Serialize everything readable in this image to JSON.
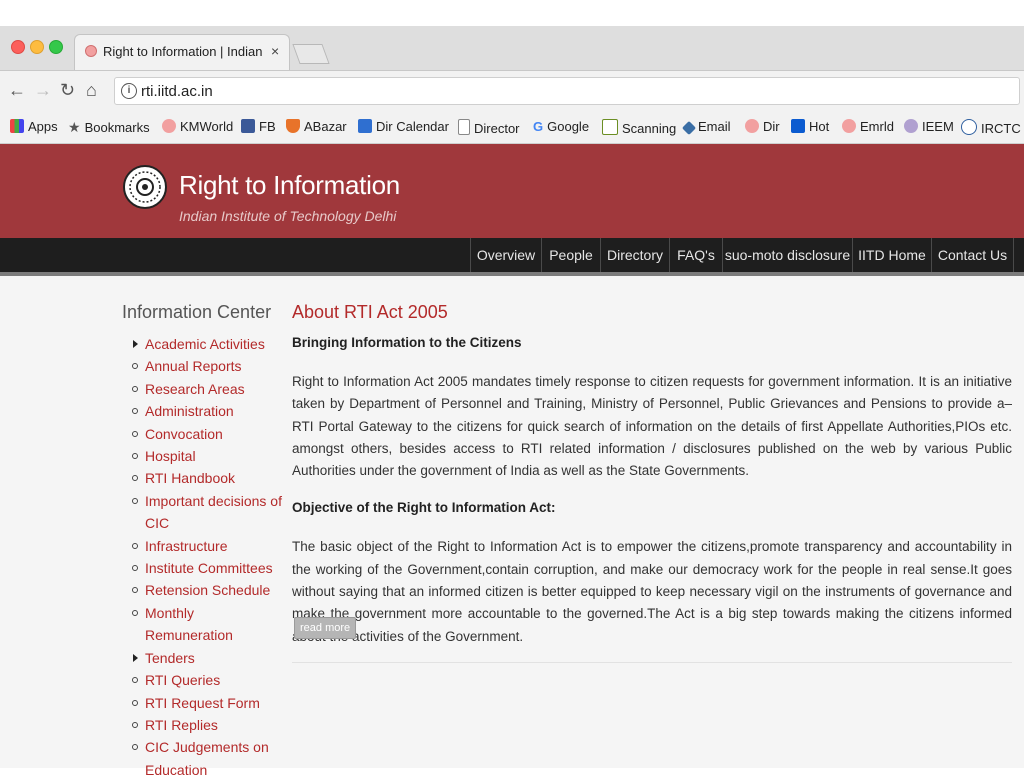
{
  "browser": {
    "tab_title": "Right to Information | Indian In",
    "tab_close": "×",
    "url": "rti.iitd.ac.in",
    "nav": {
      "back": "←",
      "forward": "→",
      "reload": "↻",
      "home": "⌂"
    },
    "bookmarks": [
      {
        "label": "Apps",
        "icon": "apps-icon",
        "color": "#e44"
      },
      {
        "label": "Bookmarks",
        "icon": "star-icon",
        "color": "#555"
      },
      {
        "label": "KMWorld",
        "icon": "kmworld-icon",
        "color": "#f2a0a0"
      },
      {
        "label": "FB",
        "icon": "facebook-icon",
        "color": "#3b5998"
      },
      {
        "label": "ABazar",
        "icon": "shield-icon",
        "color": "#e8732a"
      },
      {
        "label": "Dir Calendar",
        "icon": "calendar-icon",
        "color": "#2f6fd0"
      },
      {
        "label": "Director",
        "icon": "page-icon",
        "color": "#ffffff"
      },
      {
        "label": "Google",
        "icon": "google-icon",
        "color": "#4285f4"
      },
      {
        "label": "Scanning",
        "icon": "scanning-icon",
        "color": "#6b8e23"
      },
      {
        "label": "Email",
        "icon": "email-icon",
        "color": "#3a6ea5"
      },
      {
        "label": "Dir",
        "icon": "dir-icon",
        "color": "#f2a0a0"
      },
      {
        "label": "Hot",
        "icon": "outlook-icon",
        "color": "#0b5bd0"
      },
      {
        "label": "Emrld",
        "icon": "emrld-icon",
        "color": "#f2a0a0"
      },
      {
        "label": "IEEM",
        "icon": "ieem-icon",
        "color": "#b0a0d0"
      },
      {
        "label": "IRCTC",
        "icon": "irctc-icon",
        "color": "#3060a0"
      }
    ]
  },
  "site": {
    "title": "Right to Information",
    "subtitle": "Indian Institute of Technology Delhi",
    "nav": [
      "Overview",
      "People",
      "Directory",
      "FAQ's",
      "suo-moto disclosure",
      "IITD Home",
      "Contact Us"
    ]
  },
  "sidebar": {
    "title": "Information Center",
    "items": [
      {
        "label": "Academic Activities",
        "bullet": "triangle"
      },
      {
        "label": "Annual Reports",
        "bullet": "circle"
      },
      {
        "label": "Research Areas",
        "bullet": "circle"
      },
      {
        "label": "Administration",
        "bullet": "circle"
      },
      {
        "label": "Convocation",
        "bullet": "circle"
      },
      {
        "label": "Hospital",
        "bullet": "circle"
      },
      {
        "label": "RTI Handbook",
        "bullet": "circle"
      },
      {
        "label": "Important decisions of CIC",
        "bullet": "circle"
      },
      {
        "label": "Infrastructure",
        "bullet": "circle"
      },
      {
        "label": "Institute Committees",
        "bullet": "circle"
      },
      {
        "label": "Retension Schedule",
        "bullet": "circle"
      },
      {
        "label": "Monthly Remuneration",
        "bullet": "circle"
      },
      {
        "label": "Tenders",
        "bullet": "triangle"
      },
      {
        "label": "RTI Queries",
        "bullet": "circle"
      },
      {
        "label": "RTI Request Form",
        "bullet": "circle"
      },
      {
        "label": "RTI Replies",
        "bullet": "circle"
      },
      {
        "label": "CIC Judgements on Education",
        "bullet": "circle"
      }
    ]
  },
  "main": {
    "title": "About RTI Act 2005",
    "heading1": "Bringing Information to the Citizens",
    "para1": "Right to Information Act 2005 mandates timely response to citizen requests for government information. It is an initiative taken by Department of Personnel and Training, Ministry of Personnel, Public Grievances and Pensions to provide a– RTI Portal Gateway to the citizens for quick search of information on the details of first Appellate Authorities,PIOs etc. amongst others, besides access to RTI related information / disclosures published on the web by various Public Authorities under the government of India as well as the State Governments.",
    "heading2": "Objective of the Right to Information Act:",
    "para2": "The basic object of the Right to Information Act is to empower the citizens,promote transparency and accountability in the working of the Government,contain corruption, and make our democracy work for the people in real sense.It goes without saying that an informed citizen is better equipped to keep necessary vigil on the instruments of governance and make the government more accountable to the governed.The Act is a big step towards making the citizens informed about the activities of the Government.",
    "read_more": "read more"
  }
}
